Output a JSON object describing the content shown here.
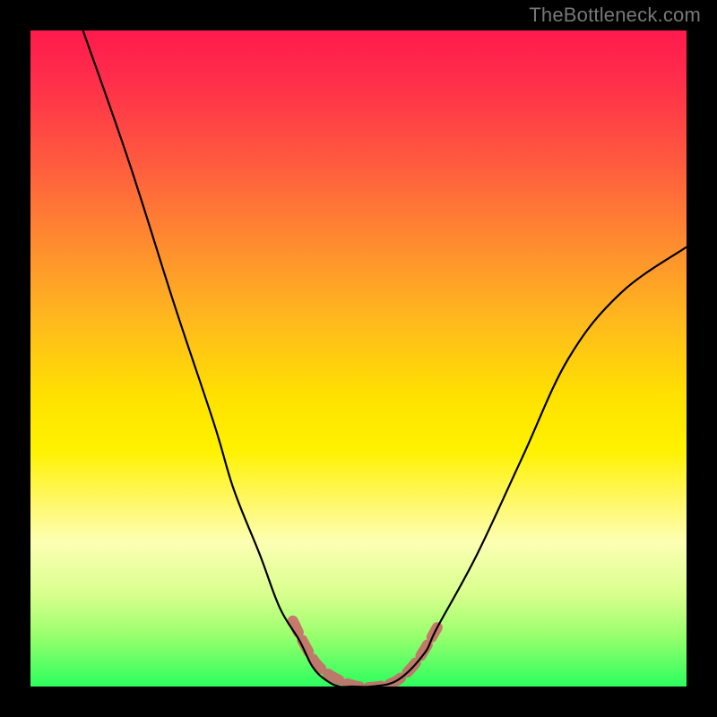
{
  "attribution": "TheBottleneck.com",
  "chart_data": {
    "type": "line",
    "title": "",
    "xlabel": "",
    "ylabel": "",
    "xlim": [
      0,
      100
    ],
    "ylim": [
      0,
      100
    ],
    "series": [
      {
        "name": "curve",
        "x": [
          8,
          15,
          22,
          28,
          31,
          35,
          38,
          41,
          43,
          45,
          47,
          49,
          52,
          56,
          60,
          62,
          68,
          75,
          82,
          90,
          100
        ],
        "y": [
          100,
          80,
          58,
          40,
          30,
          20,
          12,
          7,
          3,
          1,
          0,
          0,
          0,
          1,
          5,
          9,
          20,
          35,
          50,
          60,
          67
        ]
      },
      {
        "name": "optimal-range-highlight",
        "x": [
          40,
          42,
          44,
          47,
          50,
          53,
          56,
          59,
          62
        ],
        "y": [
          10,
          6,
          3,
          1,
          0,
          0,
          1,
          4,
          9
        ]
      }
    ],
    "colors": {
      "curve": "#000000",
      "highlight": "#c96a6a",
      "gradient_top": "#ff1a4d",
      "gradient_mid": "#ffe200",
      "gradient_bottom": "#2cff5e"
    }
  }
}
